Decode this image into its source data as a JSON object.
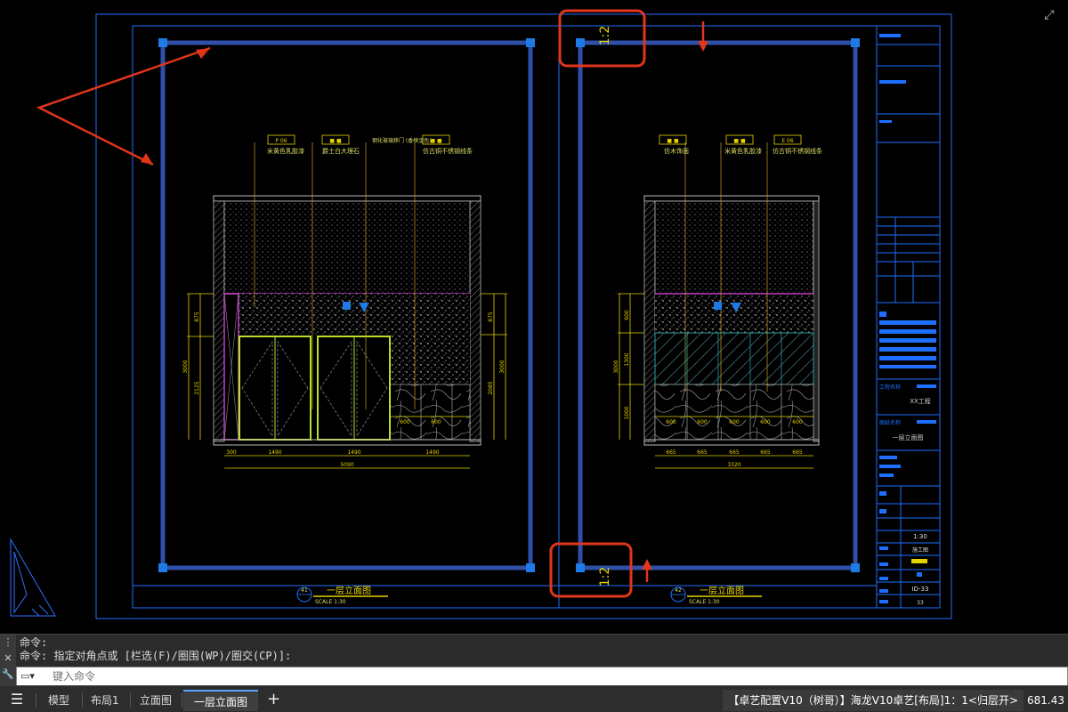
{
  "drawing": {
    "left_elevation": {
      "tags": [
        {
          "code": "P 06",
          "desc": "米黄色乳胶漆"
        },
        {
          "code": "■ ■",
          "desc": "爵士白大理石"
        },
        {
          "code": "",
          "desc": "钢化玻璃移门 (香槟金色)"
        },
        {
          "code": "■ ■",
          "desc": "仿古铜不锈钢线条"
        }
      ],
      "dims_bottom": [
        "300",
        "1490",
        "1490",
        "1490"
      ],
      "dim_total": "5090",
      "dims_left": [
        "875",
        "2125"
      ],
      "dim_left_total": "3000",
      "dims_right": [
        "875",
        "2085"
      ],
      "dim_right_total": "3000",
      "dims_small": [
        "600",
        "600"
      ],
      "title_num": "41",
      "title": "一层立面图",
      "scale": "SCALE 1:30"
    },
    "right_elevation": {
      "tags": [
        {
          "code": "■ ■",
          "desc": "仿木饰面"
        },
        {
          "code": "■ ■",
          "desc": "米黄色乳胶漆"
        },
        {
          "code": "E 06",
          "desc": "仿古铜不锈钢线条"
        }
      ],
      "dims_bottom": [
        "665",
        "665",
        "665",
        "665",
        "665"
      ],
      "dim_total": "3320",
      "dims_left": [
        "600",
        "1300",
        "1000"
      ],
      "dim_left_total": "3000",
      "dims_small": [
        "600",
        "600",
        "600",
        "600",
        "600"
      ],
      "title_num": "42",
      "title": "一层立面图",
      "scale": "SCALE 1:30"
    },
    "viewport_scale_top": "1:2",
    "viewport_scale_bottom": "1:2",
    "title_block": {
      "project_label": "工程名称",
      "project_value": "XX工程",
      "drawing_label": "图纸名称",
      "drawing_value": "一层立面图",
      "scale_value": "1:30",
      "stage_value": "施工图",
      "sheet_no": "ID-33",
      "page_no": "33"
    }
  },
  "command": {
    "line1": "命令:",
    "line2": "命令: 指定对角点或 [栏选(F)/圈围(WP)/圈交(CP)]:",
    "placeholder": "键入命令"
  },
  "tabs": [
    {
      "label": "模型",
      "active": false
    },
    {
      "label": "布局1",
      "active": false
    },
    {
      "label": "立面图",
      "active": false
    },
    {
      "label": "一层立面图",
      "active": true
    }
  ],
  "add_tab": "+",
  "status_text": "【卓艺配置V10（树哥）】海龙V10卓艺[布局]1：1<归层开>",
  "coord_text": "681.43",
  "colors": {
    "frame_blue": "#1e6fff",
    "viewport_blue": "#2f4fa8",
    "grip_blue": "#1e7be6",
    "highlight_red": "#e0361c",
    "dim_yellow": "#e6d200",
    "wall_gray": "#bbbbbb",
    "magenta": "#c040c0",
    "door_green": "#b8e02a"
  }
}
